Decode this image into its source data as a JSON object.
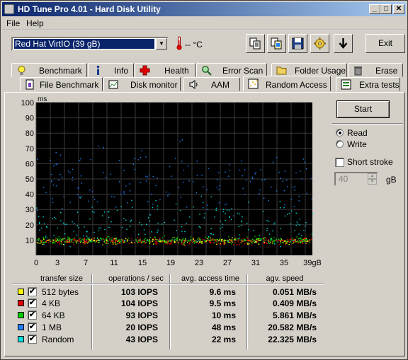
{
  "window": {
    "title": "HD Tune Pro 4.01 - Hard Disk Utility"
  },
  "title_buttons": {
    "minimize": "_",
    "maximize": "□",
    "close": "✕"
  },
  "menu": {
    "file": "File",
    "help": "Help"
  },
  "toolbar": {
    "drive": "Red Hat VirtIO (39 gB)",
    "temperature": "-- °C",
    "exit": "Exit"
  },
  "tabs_row1": [
    "Benchmark",
    "Info",
    "Health",
    "Error Scan",
    "Folder Usage",
    "Erase"
  ],
  "tabs_row2": [
    "File Benchmark",
    "Disk monitor",
    "AAM",
    "Random Access",
    "Extra tests"
  ],
  "side": {
    "start": "Start",
    "read": "Read",
    "write": "Write",
    "short_stroke": "Short stroke",
    "stroke_value": "40",
    "stroke_unit": "gB"
  },
  "chart_data": {
    "type": "scatter",
    "ylabel": "ms",
    "xlabel_unit": "gB",
    "ylim": [
      0,
      100
    ],
    "xlim": [
      0,
      39
    ],
    "y_ticks": [
      10,
      20,
      30,
      40,
      50,
      60,
      70,
      80,
      90,
      100
    ],
    "x_ticks": [
      "0",
      "3",
      "7",
      "11",
      "15",
      "19",
      "23",
      "27",
      "31",
      "35",
      "39gB"
    ],
    "background": "#000000",
    "grid": true,
    "series": [
      {
        "name": "512 bytes",
        "color": "#ffff00",
        "avg_access_ms": 9.6
      },
      {
        "name": "4 KB",
        "color": "#e00000",
        "avg_access_ms": 9.5
      },
      {
        "name": "64 KB",
        "color": "#00d000",
        "avg_access_ms": 10
      },
      {
        "name": "1 MB",
        "color": "#2080ff",
        "avg_access_ms": 48
      },
      {
        "name": "Random",
        "color": "#00e0e0",
        "avg_access_ms": 22
      }
    ]
  },
  "table": {
    "headers": [
      "transfer size",
      "operations / sec",
      "avg. access time",
      "agv. speed"
    ],
    "rows": [
      {
        "name": "512 bytes",
        "ops": "103 IOPS",
        "access": "9.6 ms",
        "speed": "0.051 MB/s",
        "color": "#ffff00"
      },
      {
        "name": "4 KB",
        "ops": "104 IOPS",
        "access": "9.5 ms",
        "speed": "0.409 MB/s",
        "color": "#e00000"
      },
      {
        "name": "64 KB",
        "ops": "93 IOPS",
        "access": "10 ms",
        "speed": "5.861 MB/s",
        "color": "#00d000"
      },
      {
        "name": "1 MB",
        "ops": "20 IOPS",
        "access": "48 ms",
        "speed": "20.582 MB/s",
        "color": "#2080ff"
      },
      {
        "name": "Random",
        "ops": "43 IOPS",
        "access": "22 ms",
        "speed": "22.325 MB/s",
        "color": "#00e0e0"
      }
    ]
  }
}
